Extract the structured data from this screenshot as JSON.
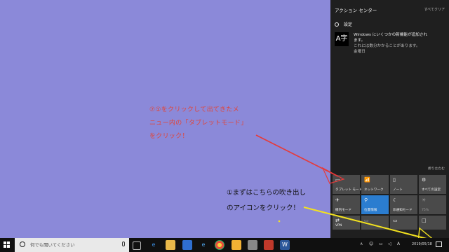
{
  "annotations": {
    "red_line1": "⑦①をクリックして出てきたメ",
    "red_line2": "ニュー内の「タブレットモード」",
    "red_line3": "をクリック！",
    "black_line1": "①まずはこちらの吹き出し",
    "black_line2": "のアイコンをクリック！"
  },
  "action_center": {
    "title": "アクション センター",
    "clear_all": "すべてクリア",
    "section_settings": "設定",
    "notification": {
      "icon_text": "A字",
      "line1": "Windows にいくつかの新機能が追加され",
      "line2": "ます。",
      "line3": "これには数分かかることがあります。",
      "time": "金曜日"
    },
    "collapse": "折りたたむ",
    "tiles": [
      {
        "label": "タブレット モード",
        "icon": "tablet-icon",
        "glyph": "▭"
      },
      {
        "label": "ネットワーク",
        "icon": "network-icon",
        "glyph": "📶"
      },
      {
        "label": "ノート",
        "icon": "note-icon",
        "glyph": "▯"
      },
      {
        "label": "すべての設定",
        "icon": "gear-icon",
        "glyph": "⚙"
      },
      {
        "label": "機内モード",
        "icon": "airplane-icon",
        "glyph": "✈"
      },
      {
        "label": "位置情報",
        "icon": "location-icon",
        "glyph": "⚲"
      },
      {
        "label": "非通知モード",
        "icon": "moon-icon",
        "glyph": "☾"
      },
      {
        "label": "75%",
        "icon": "brightness-icon",
        "glyph": "☀"
      },
      {
        "label": "VPN",
        "icon": "vpn-icon",
        "glyph": "⇄"
      },
      {
        "label": "",
        "icon": "project-icon",
        "glyph": "▭"
      },
      {
        "label": "",
        "icon": "connect-icon",
        "glyph": "▭"
      },
      {
        "label": "",
        "icon": "quiet-icon",
        "glyph": "□"
      }
    ]
  },
  "taskbar": {
    "search_placeholder": "何でも聞いてください",
    "clock": "2019/05/18",
    "accent": "#2b7dd0"
  }
}
